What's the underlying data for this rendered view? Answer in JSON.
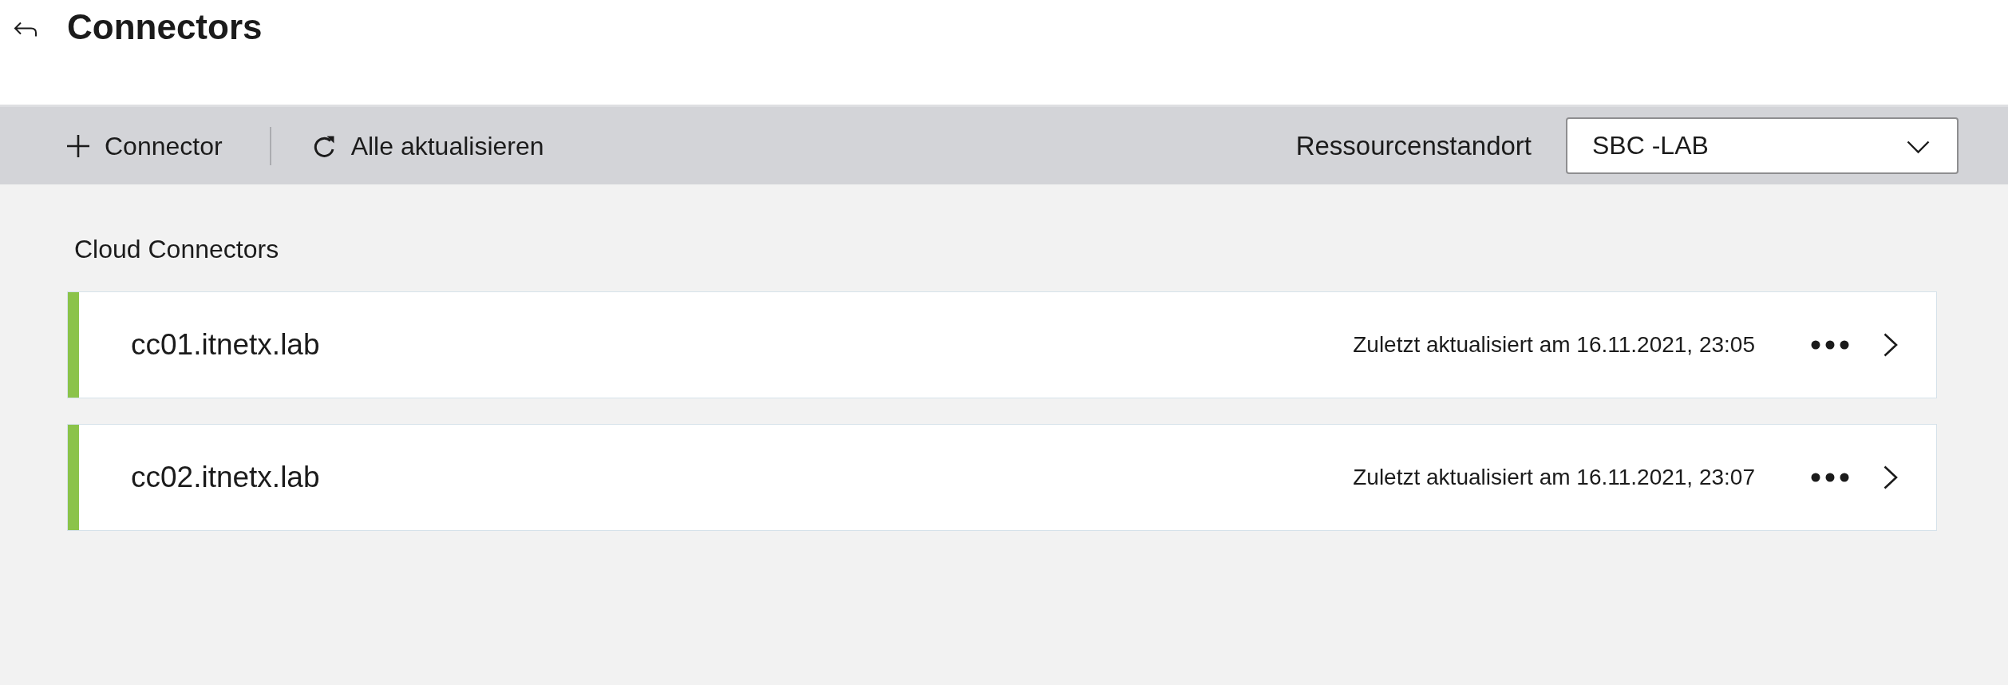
{
  "header": {
    "title": "Connectors"
  },
  "toolbar": {
    "actions": [
      {
        "kind": "add",
        "label": "Connector"
      },
      {
        "kind": "refresh",
        "label": "Alle aktualisieren"
      }
    ],
    "location": {
      "label": "Ressourcenstandort",
      "value": "SBC -LAB"
    }
  },
  "section": {
    "title": "Cloud Connectors",
    "connectors": [
      {
        "name": "cc01.itnetx.lab",
        "updated": "Zuletzt aktualisiert am 16.11.2021, 23:05",
        "color": "#8bc34a"
      },
      {
        "name": "cc02.itnetx.lab",
        "updated": "Zuletzt aktualisiert am 16.11.2021, 23:07",
        "color": "#8bc34a"
      }
    ]
  }
}
